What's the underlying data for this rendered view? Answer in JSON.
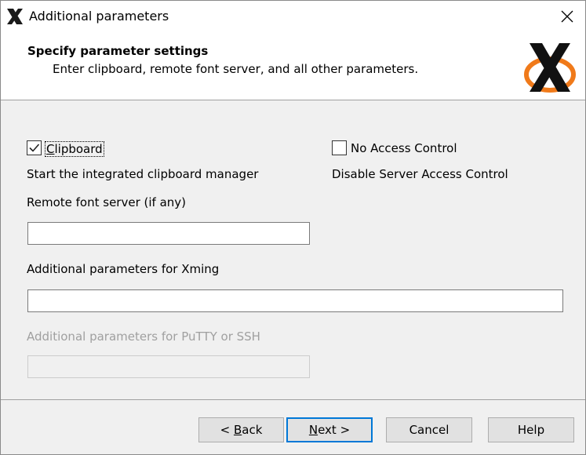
{
  "window": {
    "title": "Additional parameters",
    "app_icon": "xming-x-icon",
    "close_icon": "close-icon"
  },
  "header": {
    "title": "Specify parameter settings",
    "subtitle": "Enter clipboard, remote font server, and all other parameters.",
    "logo_icon": "x-window-logo"
  },
  "options": {
    "clipboard": {
      "label_prefix": "",
      "label_accel": "C",
      "label_rest": "lipboard",
      "checked": true,
      "description": "Start the integrated clipboard manager"
    },
    "no_access_control": {
      "label": "No Access Control",
      "checked": false,
      "description": "Disable Server Access Control"
    }
  },
  "fields": {
    "font_server": {
      "label": "Remote font server (if any)",
      "value": ""
    },
    "xming_params": {
      "label": "Additional parameters for Xming",
      "value": ""
    },
    "putty_params": {
      "label": "Additional parameters for PuTTY or SSH",
      "value": "",
      "disabled": true
    }
  },
  "buttons": {
    "back": {
      "prefix": "< ",
      "accel": "B",
      "rest": "ack"
    },
    "next": {
      "accel": "N",
      "rest": "ext >"
    },
    "cancel": "Cancel",
    "help": "Help"
  },
  "colors": {
    "default_button_border": "#0078d7",
    "logo_orange": "#f07a1a"
  }
}
